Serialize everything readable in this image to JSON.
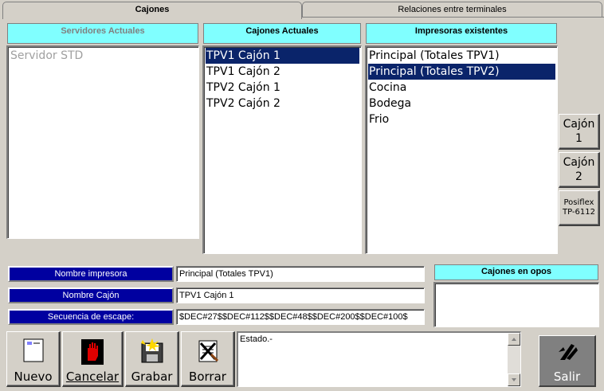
{
  "tabs": {
    "cajones": "Cajones",
    "relaciones": "Relaciones entre terminales"
  },
  "servidores": {
    "header": "Servidores Actuales",
    "items": [
      "Servidor STD"
    ]
  },
  "cajones": {
    "header": "Cajones Actuales",
    "items": [
      "TPV1 Cajón 1",
      "TPV1 Cajón 2",
      "TPV2 Cajón 1",
      "TPV2 Cajón 2"
    ],
    "selected": "TPV1 Cajón 1"
  },
  "impresoras": {
    "header": "Impresoras existentes",
    "items": [
      "Principal (Totales TPV1)",
      "Principal (Totales TPV2)",
      "Cocina",
      "Bodega",
      "Frio"
    ],
    "selected": "Principal (Totales TPV2)"
  },
  "side_buttons": {
    "cajon1_line1": "Cajón",
    "cajon1_line2": "1",
    "cajon2_line1": "Cajón",
    "cajon2_line2": "2",
    "posiflex_line1": "Posiflex",
    "posiflex_line2": "TP-6112"
  },
  "form": {
    "nombre_impresora_label": "Nombre impresora",
    "nombre_impresora_value": "Principal (Totales TPV1)",
    "nombre_cajon_label": "Nombre Cajón",
    "nombre_cajon_value": "TPV1 Cajón 1",
    "secuencia_label": "Secuencia de escape:",
    "secuencia_value": "$DEC#27$$DEC#112$$DEC#48$$DEC#200$$DEC#100$"
  },
  "opos": {
    "header": "Cajones en opos"
  },
  "toolbar": {
    "nuevo": "Nuevo",
    "cancelar": "Cancelar",
    "grabar": "Grabar",
    "borrar": "Borrar",
    "salir": "Salir"
  },
  "status": {
    "text": "Estado.-"
  },
  "colors": {
    "header_bg": "#80ffff",
    "label_bg": "#0000a0",
    "selection_bg": "#0a246a",
    "window_bg": "#d4d0c8"
  }
}
